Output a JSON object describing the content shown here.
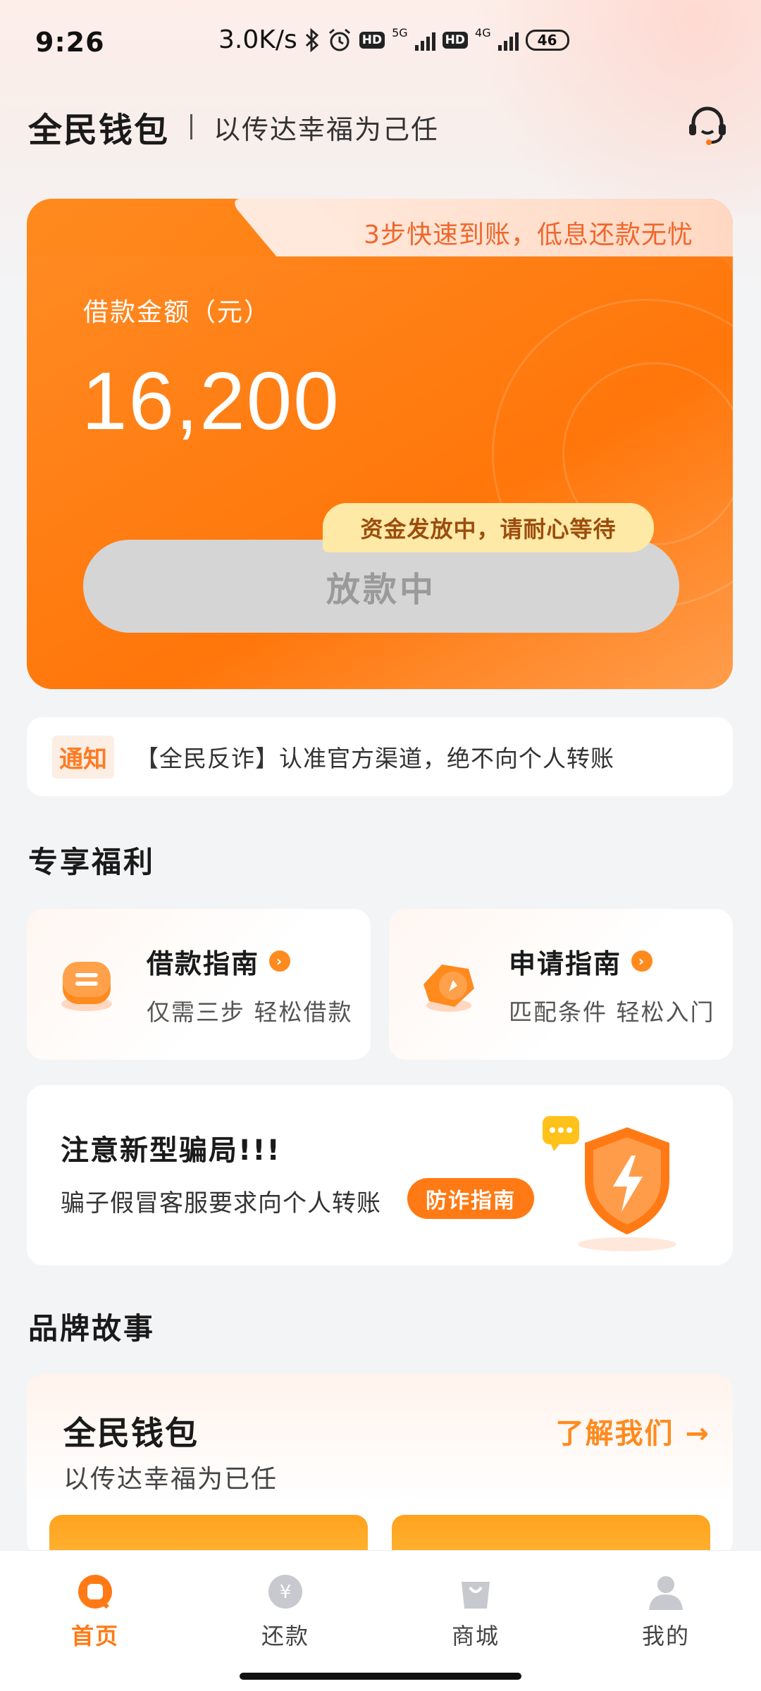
{
  "status_bar": {
    "time": "9:26",
    "net_speed": "3.0K/s",
    "hd": "HD",
    "net1": "5G",
    "net2": "4G",
    "battery": "46"
  },
  "header": {
    "brand": "全民钱包",
    "slogan": "以传达幸福为己任",
    "support_icon": "headset-icon"
  },
  "loan_card": {
    "tab_text": "3步快速到账，低息还款无忧",
    "amount_label": "借款金额（元）",
    "amount": "16,200",
    "tip": "资金发放中，请耐心等待",
    "status_button": "放款中"
  },
  "notice": {
    "tag": "通知",
    "text": "【全民反诈】认准官方渠道，绝不向个人转账"
  },
  "welfare": {
    "title": "专享福利",
    "cards": [
      {
        "title": "借款指南",
        "subtitle": "仅需三步 轻松借款",
        "icon": "loan-guide-icon"
      },
      {
        "title": "申请指南",
        "subtitle": "匹配条件 轻松入门",
        "icon": "apply-guide-icon"
      }
    ]
  },
  "fraud": {
    "title": "注意新型骗局!!!",
    "desc": "骗子假冒客服要求向个人转账",
    "button": "防诈指南",
    "icon": "shield-lightning-icon"
  },
  "story": {
    "section_title": "品牌故事",
    "brand": "全民钱包",
    "slogan": "以传达幸福为已任",
    "more": "了解我们 →"
  },
  "nav": {
    "items": [
      {
        "label": "首页",
        "icon": "home-icon",
        "active": true
      },
      {
        "label": "还款",
        "icon": "repay-icon",
        "active": false
      },
      {
        "label": "商城",
        "icon": "shop-icon",
        "active": false
      },
      {
        "label": "我的",
        "icon": "profile-icon",
        "active": false
      }
    ]
  },
  "colors": {
    "accent": "#ff7a14",
    "card_orange": "#ff8a1e",
    "tip_bg": "#ffe9a6",
    "disabled_button": "#d5d5d5"
  }
}
